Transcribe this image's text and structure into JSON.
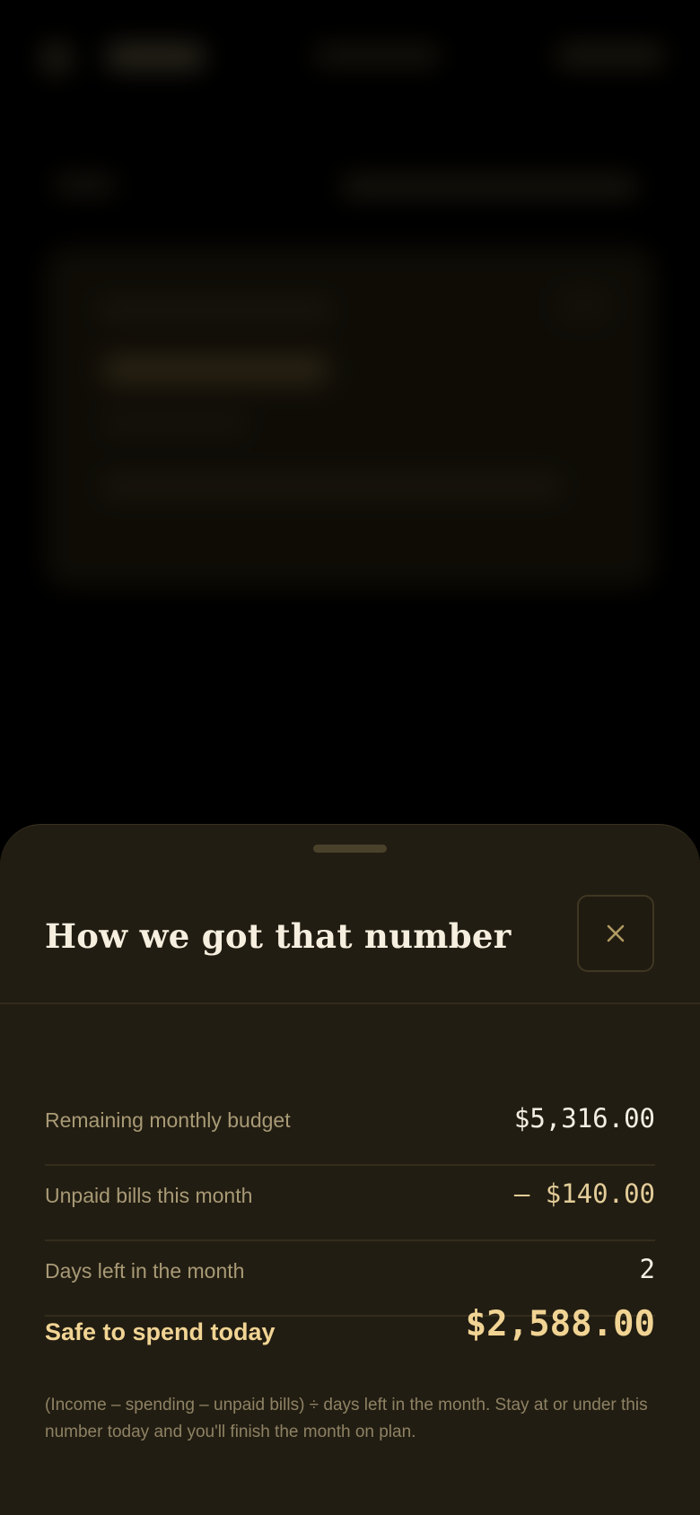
{
  "sheet": {
    "title": "How we got that number",
    "close_label": "×",
    "rows": [
      {
        "label": "Remaining monthly budget",
        "value": "$5,316.00",
        "kind": "base"
      },
      {
        "label": "Unpaid bills this month",
        "value": "– $140.00",
        "kind": "deduction"
      },
      {
        "label": "Days left in the month",
        "value": "2",
        "kind": "divisor"
      }
    ],
    "total": {
      "label": "Safe to spend today",
      "value": "$2,588.00"
    },
    "footnote": "(Income – spending – unpaid bills) ÷ days left in the month. Stay at or under this number today and you'll finish the month on plan."
  },
  "icons": {
    "close": "close-icon"
  },
  "colors": {
    "accent": "#f1d494",
    "sheet_background": "#221d12",
    "label": "#a89a76",
    "value": "#f4eee2",
    "deduction": "#e2cc98"
  }
}
